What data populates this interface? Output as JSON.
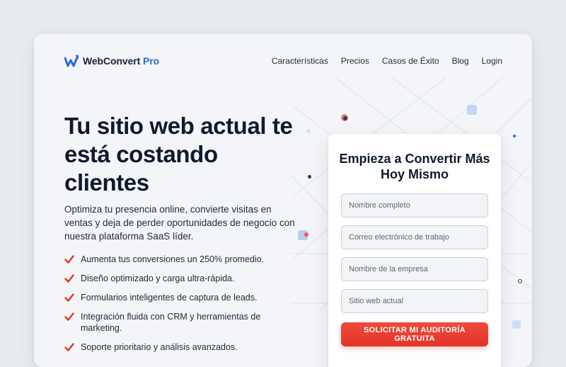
{
  "brand": {
    "name": "WebConvert",
    "suffix": "Pro",
    "accent_color": "#2b6bd6",
    "logo_icon": "w-chart-icon"
  },
  "nav": {
    "items": [
      {
        "label": "Características"
      },
      {
        "label": "Precios"
      },
      {
        "label": "Casos de Éxito"
      },
      {
        "label": "Blog"
      },
      {
        "label": "Login"
      }
    ]
  },
  "hero": {
    "title": "Tu sitio web actual te está costando clientes",
    "subtitle": "Optimiza tu presencia online, convierte visitas en ventas y deja de perder oportunidades de negocio con nuestra plataforma SaaS líder.",
    "check_icon": "checkmark-icon",
    "check_color": "#e0352a",
    "features": [
      "Aumenta tus conversiones un 250% promedio.",
      "Diseño optimizado y carga ultra-rápida.",
      "Formularios inteligentes de captura de leads.",
      "Integración fluida con CRM y herramientas de marketing.",
      "Soporte prioritario y análisis avanzados."
    ]
  },
  "form": {
    "title": "Empieza a Convertir Más Hoy Mismo",
    "fields": {
      "name": {
        "placeholder": "Nombre completo",
        "value": ""
      },
      "email": {
        "placeholder": "Correo electrónico de trabajo",
        "value": ""
      },
      "company": {
        "placeholder": "Nombre de la empresa",
        "value": ""
      },
      "website": {
        "placeholder": "Sitio web actual",
        "value": ""
      }
    },
    "submit_label": "SOLICITAR MI AUDITORÍA GRATUITA",
    "submit_color": "#e0352a"
  }
}
